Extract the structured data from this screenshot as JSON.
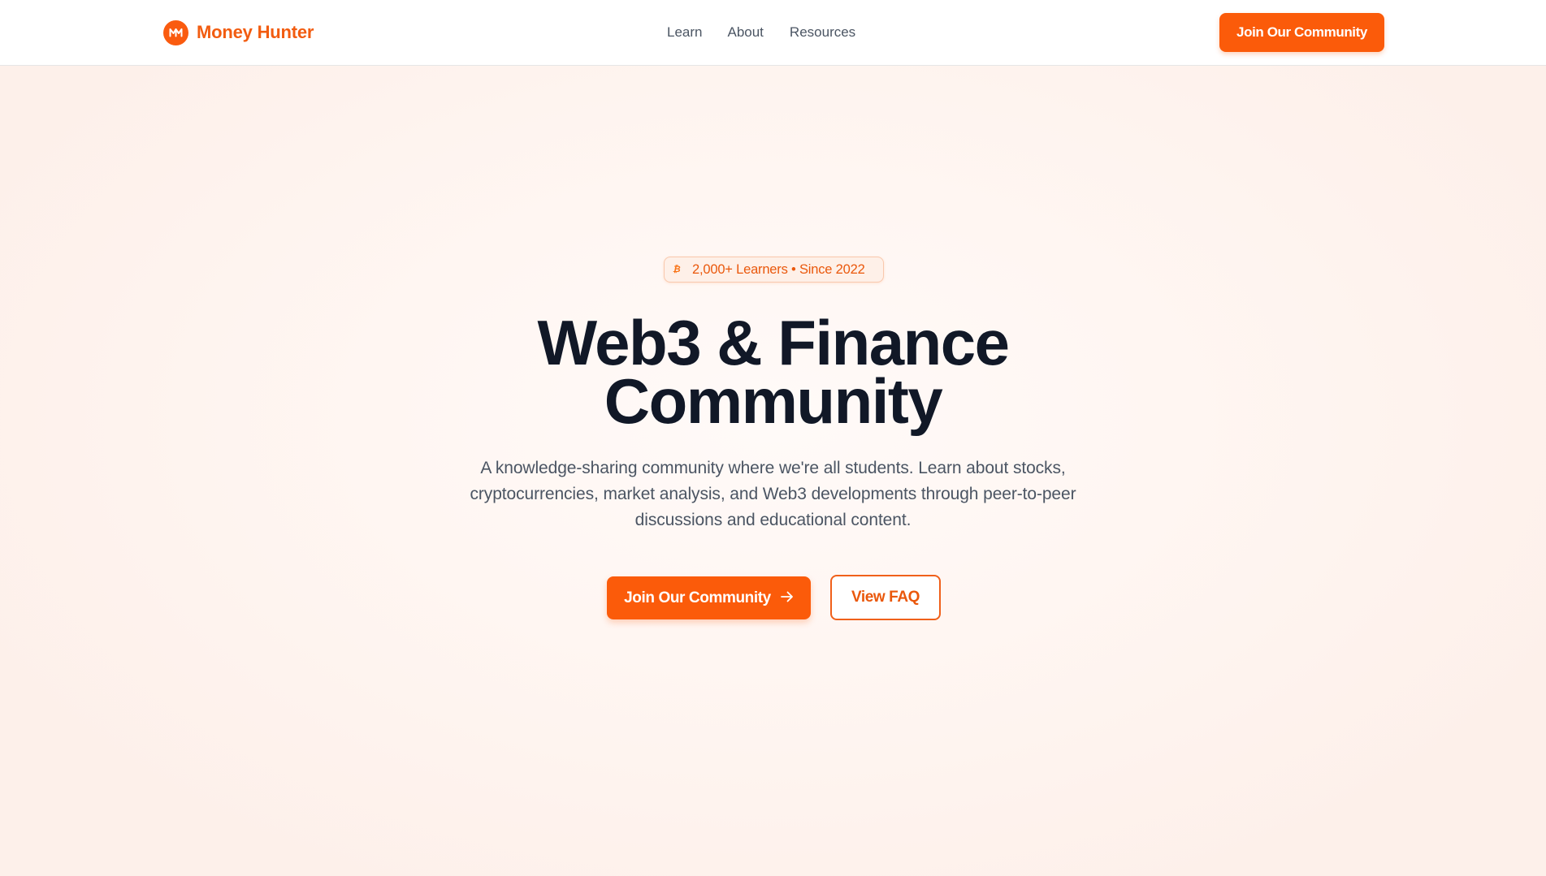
{
  "header": {
    "logo_text": "Money Hunter",
    "nav": [
      {
        "label": "Learn"
      },
      {
        "label": "About"
      },
      {
        "label": "Resources"
      }
    ],
    "cta_label": "Join Our Community"
  },
  "hero": {
    "badge_icon": "bitcoin-icon",
    "badge_text": "2,000+ Learners • Since 2022",
    "title_line1": "Web3 & Finance",
    "title_line2": "Community",
    "description": "A knowledge-sharing community where we're all students. Learn about stocks, cryptocurrencies, market analysis, and Web3 developments through peer-to-peer discussions and educational content.",
    "primary_button": "Join Our Community",
    "secondary_button": "View FAQ"
  },
  "colors": {
    "accent": "#fb5b0a",
    "text_dark": "#111827",
    "text_muted": "#4b5563",
    "badge_bg": "#fef0e8"
  }
}
